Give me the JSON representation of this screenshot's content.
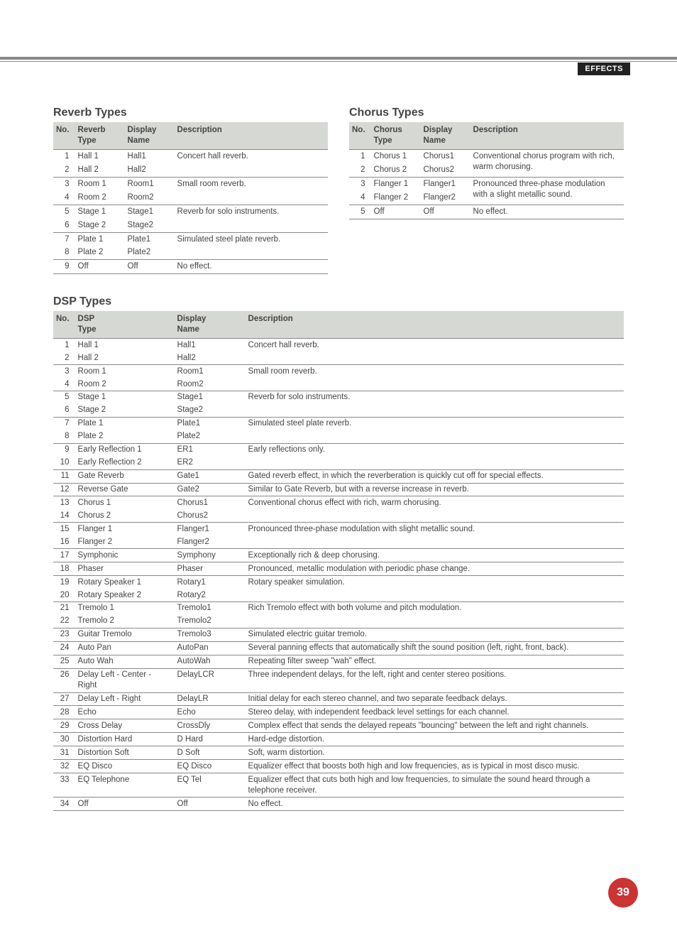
{
  "header": {
    "tag": "EFFECTS"
  },
  "page_number": "39",
  "reverb": {
    "title": "Reverb Types",
    "headers": {
      "no": "No.",
      "type": "Reverb\nType",
      "display": "Display\nName",
      "desc": "Description"
    },
    "groups": [
      {
        "rows": [
          {
            "no": "1",
            "type": "Hall 1",
            "display": "Hall1"
          },
          {
            "no": "2",
            "type": "Hall 2",
            "display": "Hall2"
          }
        ],
        "desc": "Concert hall reverb."
      },
      {
        "rows": [
          {
            "no": "3",
            "type": "Room 1",
            "display": "Room1"
          },
          {
            "no": "4",
            "type": "Room 2",
            "display": "Room2"
          }
        ],
        "desc": "Small room reverb."
      },
      {
        "rows": [
          {
            "no": "5",
            "type": "Stage 1",
            "display": "Stage1"
          },
          {
            "no": "6",
            "type": "Stage 2",
            "display": "Stage2"
          }
        ],
        "desc": "Reverb for solo instruments."
      },
      {
        "rows": [
          {
            "no": "7",
            "type": "Plate 1",
            "display": "Plate1"
          },
          {
            "no": "8",
            "type": "Plate 2",
            "display": "Plate2"
          }
        ],
        "desc": "Simulated steel plate reverb."
      },
      {
        "rows": [
          {
            "no": "9",
            "type": "Off",
            "display": "Off"
          }
        ],
        "desc": "No effect."
      }
    ]
  },
  "chorus": {
    "title": "Chorus Types",
    "headers": {
      "no": "No.",
      "type": "Chorus\nType",
      "display": "Display\nName",
      "desc": "Description"
    },
    "groups": [
      {
        "rows": [
          {
            "no": "1",
            "type": "Chorus 1",
            "display": "Chorus1"
          },
          {
            "no": "2",
            "type": "Chorus 2",
            "display": "Chorus2"
          }
        ],
        "desc": "Conventional chorus program with rich, warm chorusing."
      },
      {
        "rows": [
          {
            "no": "3",
            "type": "Flanger 1",
            "display": "Flanger1"
          },
          {
            "no": "4",
            "type": "Flanger 2",
            "display": "Flanger2"
          }
        ],
        "desc": "Pronounced three-phase modulation with a slight metallic sound."
      },
      {
        "rows": [
          {
            "no": "5",
            "type": "Off",
            "display": "Off"
          }
        ],
        "desc": "No effect."
      }
    ]
  },
  "dsp": {
    "title": "DSP Types",
    "headers": {
      "no": "No.",
      "type": "DSP\nType",
      "display": "Display\nName",
      "desc": "Description"
    },
    "groups": [
      {
        "rows": [
          {
            "no": "1",
            "type": "Hall 1",
            "display": "Hall1"
          },
          {
            "no": "2",
            "type": "Hall 2",
            "display": "Hall2"
          }
        ],
        "desc": "Concert hall reverb."
      },
      {
        "rows": [
          {
            "no": "3",
            "type": "Room 1",
            "display": "Room1"
          },
          {
            "no": "4",
            "type": "Room 2",
            "display": "Room2"
          }
        ],
        "desc": "Small room reverb."
      },
      {
        "rows": [
          {
            "no": "5",
            "type": "Stage 1",
            "display": "Stage1"
          },
          {
            "no": "6",
            "type": "Stage 2",
            "display": "Stage2"
          }
        ],
        "desc": "Reverb for solo instruments."
      },
      {
        "rows": [
          {
            "no": "7",
            "type": "Plate 1",
            "display": "Plate1"
          },
          {
            "no": "8",
            "type": "Plate 2",
            "display": "Plate2"
          }
        ],
        "desc": "Simulated steel plate reverb."
      },
      {
        "rows": [
          {
            "no": "9",
            "type": "Early Reflection 1",
            "display": "ER1"
          },
          {
            "no": "10",
            "type": "Early Reflection 2",
            "display": "ER2"
          }
        ],
        "desc": "Early reflections only."
      },
      {
        "rows": [
          {
            "no": "11",
            "type": "Gate Reverb",
            "display": "Gate1"
          }
        ],
        "desc": "Gated reverb effect, in which the reverberation is quickly cut off for special effects."
      },
      {
        "rows": [
          {
            "no": "12",
            "type": "Reverse Gate",
            "display": "Gate2"
          }
        ],
        "desc": "Similar to Gate Reverb, but with a reverse increase in reverb."
      },
      {
        "rows": [
          {
            "no": "13",
            "type": "Chorus 1",
            "display": "Chorus1"
          },
          {
            "no": "14",
            "type": "Chorus 2",
            "display": "Chorus2"
          }
        ],
        "desc": "Conventional chorus effect with rich, warm chorusing."
      },
      {
        "rows": [
          {
            "no": "15",
            "type": "Flanger 1",
            "display": "Flanger1"
          },
          {
            "no": "16",
            "type": "Flanger 2",
            "display": "Flanger2"
          }
        ],
        "desc": "Pronounced three-phase modulation with slight metallic sound."
      },
      {
        "rows": [
          {
            "no": "17",
            "type": "Symphonic",
            "display": "Symphony"
          }
        ],
        "desc": "Exceptionally rich & deep chorusing."
      },
      {
        "rows": [
          {
            "no": "18",
            "type": "Phaser",
            "display": "Phaser"
          }
        ],
        "desc": "Pronounced, metallic modulation with periodic phase change."
      },
      {
        "rows": [
          {
            "no": "19",
            "type": "Rotary Speaker 1",
            "display": "Rotary1"
          },
          {
            "no": "20",
            "type": "Rotary Speaker 2",
            "display": "Rotary2"
          }
        ],
        "desc": "Rotary speaker simulation."
      },
      {
        "rows": [
          {
            "no": "21",
            "type": "Tremolo 1",
            "display": "Tremolo1"
          },
          {
            "no": "22",
            "type": "Tremolo 2",
            "display": "Tremolo2"
          }
        ],
        "desc": "Rich Tremolo effect with both volume and pitch modulation."
      },
      {
        "rows": [
          {
            "no": "23",
            "type": "Guitar Tremolo",
            "display": "Tremolo3"
          }
        ],
        "desc": "Simulated electric guitar tremolo."
      },
      {
        "rows": [
          {
            "no": "24",
            "type": "Auto Pan",
            "display": "AutoPan"
          }
        ],
        "desc": "Several panning effects that automatically shift the sound position (left, right, front, back)."
      },
      {
        "rows": [
          {
            "no": "25",
            "type": "Auto Wah",
            "display": "AutoWah"
          }
        ],
        "desc": "Repeating filter sweep \"wah\" effect."
      },
      {
        "rows": [
          {
            "no": "26",
            "type": "Delay Left - Center - Right",
            "display": "DelayLCR"
          }
        ],
        "desc": "Three independent delays, for the left, right and center stereo positions."
      },
      {
        "rows": [
          {
            "no": "27",
            "type": "Delay Left - Right",
            "display": "DelayLR"
          }
        ],
        "desc": "Initial delay for each stereo channel, and two separate feedback delays."
      },
      {
        "rows": [
          {
            "no": "28",
            "type": "Echo",
            "display": "Echo"
          }
        ],
        "desc": "Stereo delay, with independent feedback level settings for each channel."
      },
      {
        "rows": [
          {
            "no": "29",
            "type": "Cross Delay",
            "display": "CrossDly"
          }
        ],
        "desc": "Complex effect that sends the delayed repeats \"bouncing\" between the left and right channels."
      },
      {
        "rows": [
          {
            "no": "30",
            "type": "Distortion Hard",
            "display": "D Hard"
          }
        ],
        "desc": "Hard-edge distortion."
      },
      {
        "rows": [
          {
            "no": "31",
            "type": "Distortion Soft",
            "display": "D Soft"
          }
        ],
        "desc": "Soft, warm distortion."
      },
      {
        "rows": [
          {
            "no": "32",
            "type": "EQ Disco",
            "display": "EQ Disco"
          }
        ],
        "desc": "Equalizer effect that boosts both high and low frequencies, as is typical in most disco music."
      },
      {
        "rows": [
          {
            "no": "33",
            "type": "EQ Telephone",
            "display": "EQ Tel"
          }
        ],
        "desc": "Equalizer effect that cuts both high and low frequencies, to simulate the sound heard through a telephone receiver."
      },
      {
        "rows": [
          {
            "no": "34",
            "type": "Off",
            "display": "Off"
          }
        ],
        "desc": "No effect."
      }
    ]
  }
}
